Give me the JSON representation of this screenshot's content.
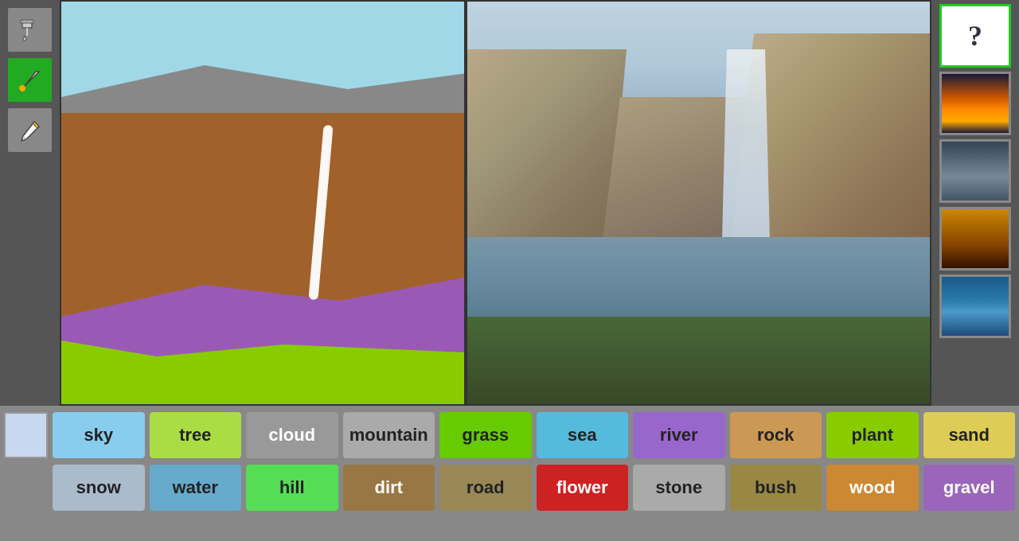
{
  "tools": [
    {
      "name": "paint-bucket",
      "label": "🪣",
      "active": false
    },
    {
      "name": "brush",
      "label": "🖌",
      "active": true
    },
    {
      "name": "pencil",
      "label": "✏",
      "active": false
    }
  ],
  "thumbnails": [
    {
      "name": "dice",
      "label": "?",
      "active": true
    },
    {
      "name": "sunset",
      "label": "",
      "active": false
    },
    {
      "name": "clouds",
      "label": "",
      "active": false
    },
    {
      "name": "dusk",
      "label": "",
      "active": false
    },
    {
      "name": "wave",
      "label": "",
      "active": false
    }
  ],
  "labels_row1": [
    {
      "key": "blank",
      "text": "",
      "color": "blank"
    },
    {
      "key": "sky",
      "text": "sky",
      "color": "sky"
    },
    {
      "key": "tree",
      "text": "tree",
      "color": "tree"
    },
    {
      "key": "cloud",
      "text": "cloud",
      "color": "cloud"
    },
    {
      "key": "mountain",
      "text": "mountain",
      "color": "mountain"
    },
    {
      "key": "grass",
      "text": "grass",
      "color": "grass"
    },
    {
      "key": "sea",
      "text": "sea",
      "color": "sea"
    },
    {
      "key": "river",
      "text": "river",
      "color": "river"
    },
    {
      "key": "rock",
      "text": "rock",
      "color": "rock"
    },
    {
      "key": "plant",
      "text": "plant",
      "color": "plant"
    },
    {
      "key": "sand",
      "text": "sand",
      "color": "sand"
    }
  ],
  "labels_row2": [
    {
      "key": "snow",
      "text": "snow",
      "color": "snow"
    },
    {
      "key": "water",
      "text": "water",
      "color": "water"
    },
    {
      "key": "hill",
      "text": "hill",
      "color": "hill"
    },
    {
      "key": "dirt",
      "text": "dirt",
      "color": "dirt"
    },
    {
      "key": "road",
      "text": "road",
      "color": "road"
    },
    {
      "key": "flower",
      "text": "flower",
      "color": "flower"
    },
    {
      "key": "stone",
      "text": "stone",
      "color": "stone"
    },
    {
      "key": "bush",
      "text": "bush",
      "color": "bush"
    },
    {
      "key": "wood",
      "text": "wood",
      "color": "wood"
    },
    {
      "key": "gravel",
      "text": "gravel",
      "color": "gravel"
    }
  ]
}
